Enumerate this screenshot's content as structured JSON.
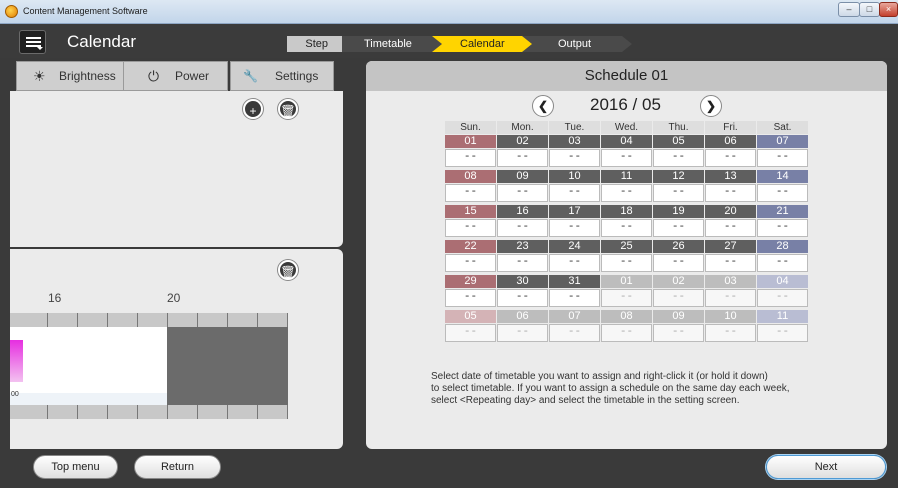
{
  "window": {
    "title": "Content Management Software",
    "min": "–",
    "max": "□",
    "close": "×"
  },
  "header": {
    "title": "Calendar"
  },
  "steps": {
    "label": "Step",
    "items": [
      "Timetable",
      "Calendar",
      "Output"
    ],
    "active": "Calendar"
  },
  "tabs": [
    {
      "label": "Brightness",
      "icon": "☀"
    },
    {
      "label": "Power",
      "icon": "⏻"
    },
    {
      "label": "Settings",
      "icon": "🔧"
    }
  ],
  "timeline": {
    "hours": [
      "16",
      "20"
    ],
    "small_label": "00"
  },
  "schedule": {
    "title": "Schedule 01",
    "month": "2016 / 05",
    "prev": "❮",
    "next": "❯",
    "weekdays": [
      "Sun.",
      "Mon.",
      "Tue.",
      "Wed.",
      "Thu.",
      "Fri.",
      "Sat."
    ],
    "weeks": [
      [
        {
          "d": "01",
          "v": "--",
          "cur": true
        },
        {
          "d": "02",
          "v": "--",
          "cur": true
        },
        {
          "d": "03",
          "v": "--",
          "cur": true
        },
        {
          "d": "04",
          "v": "--",
          "cur": true
        },
        {
          "d": "05",
          "v": "--",
          "cur": true
        },
        {
          "d": "06",
          "v": "--",
          "cur": true
        },
        {
          "d": "07",
          "v": "--",
          "cur": true
        }
      ],
      [
        {
          "d": "08",
          "v": "--",
          "cur": true
        },
        {
          "d": "09",
          "v": "--",
          "cur": true
        },
        {
          "d": "10",
          "v": "--",
          "cur": true
        },
        {
          "d": "11",
          "v": "--",
          "cur": true
        },
        {
          "d": "12",
          "v": "--",
          "cur": true
        },
        {
          "d": "13",
          "v": "--",
          "cur": true
        },
        {
          "d": "14",
          "v": "--",
          "cur": true
        }
      ],
      [
        {
          "d": "15",
          "v": "--",
          "cur": true
        },
        {
          "d": "16",
          "v": "--",
          "cur": true
        },
        {
          "d": "17",
          "v": "--",
          "cur": true
        },
        {
          "d": "18",
          "v": "--",
          "cur": true
        },
        {
          "d": "19",
          "v": "--",
          "cur": true
        },
        {
          "d": "20",
          "v": "--",
          "cur": true
        },
        {
          "d": "21",
          "v": "--",
          "cur": true
        }
      ],
      [
        {
          "d": "22",
          "v": "--",
          "cur": true
        },
        {
          "d": "23",
          "v": "--",
          "cur": true
        },
        {
          "d": "24",
          "v": "--",
          "cur": true
        },
        {
          "d": "25",
          "v": "--",
          "cur": true
        },
        {
          "d": "26",
          "v": "--",
          "cur": true
        },
        {
          "d": "27",
          "v": "--",
          "cur": true
        },
        {
          "d": "28",
          "v": "--",
          "cur": true
        }
      ],
      [
        {
          "d": "29",
          "v": "--",
          "cur": true
        },
        {
          "d": "30",
          "v": "--",
          "cur": true
        },
        {
          "d": "31",
          "v": "--",
          "cur": true
        },
        {
          "d": "01",
          "v": "--",
          "cur": false
        },
        {
          "d": "02",
          "v": "--",
          "cur": false
        },
        {
          "d": "03",
          "v": "--",
          "cur": false
        },
        {
          "d": "04",
          "v": "--",
          "cur": false
        }
      ],
      [
        {
          "d": "05",
          "v": "--",
          "cur": false
        },
        {
          "d": "06",
          "v": "--",
          "cur": false
        },
        {
          "d": "07",
          "v": "--",
          "cur": false
        },
        {
          "d": "08",
          "v": "--",
          "cur": false
        },
        {
          "d": "09",
          "v": "--",
          "cur": false
        },
        {
          "d": "10",
          "v": "--",
          "cur": false
        },
        {
          "d": "11",
          "v": "--",
          "cur": false
        }
      ]
    ],
    "help": [
      "Select date of timetable you want to assign and right-click it (or hold it down)",
      "to select timetable. If you want to assign a schedule on the same day each week,",
      "select <Repeating day> and select the timetable in the setting screen."
    ]
  },
  "footer": {
    "top_menu": "Top menu",
    "return": "Return",
    "next": "Next"
  },
  "colors": {
    "active_step": "#ffd400",
    "sunday": "#ab6e73",
    "saturday": "#7880a6",
    "weekday": "#5f5f5f"
  }
}
